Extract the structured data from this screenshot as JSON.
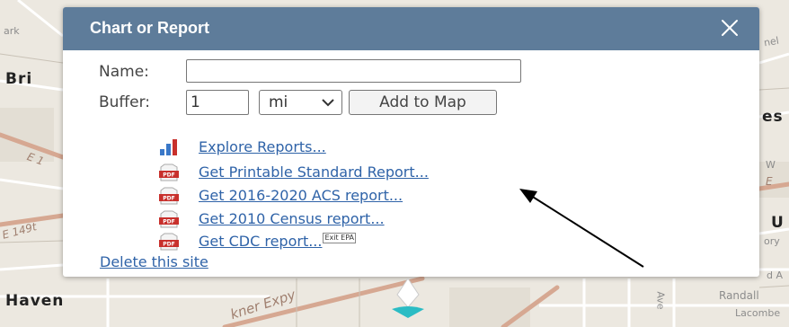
{
  "map": {
    "labels": {
      "park": "ark",
      "bri": "Bri",
      "nel": "nel",
      "es": "es",
      "e1a": "E 1",
      "w": "W",
      "e": "E",
      "e149": "E 149t",
      "u": "U",
      "ory": "ory",
      "da": "d A",
      "haven": "Haven",
      "expy": "kner Expy",
      "ave": "Ave",
      "randall": "Randall",
      "lacombe": "Lacombe"
    }
  },
  "popup": {
    "title": "Chart or Report",
    "close_icon": "close-icon",
    "form": {
      "name_label": "Name:",
      "name_value": "",
      "buffer_label": "Buffer:",
      "buffer_value": "1",
      "unit_selected": "mi",
      "add_button": "Add to Map"
    },
    "reports": [
      {
        "icon": "bar-chart-icon",
        "label": "Explore Reports..."
      },
      {
        "icon": "pdf-icon",
        "label": "Get Printable Standard Report..."
      },
      {
        "icon": "pdf-icon",
        "label": "Get 2016-2020 ACS report..."
      },
      {
        "icon": "pdf-icon",
        "label": "Get 2010 Census report..."
      },
      {
        "icon": "pdf-icon",
        "label": "Get CDC report..."
      }
    ],
    "exit_badge": "Exit EPA",
    "delete_link": "Delete this site",
    "pdf_icon_text": "PDF"
  },
  "colors": {
    "header": "#5e7c9a",
    "link": "#2f63a8",
    "pdf_red": "#c8302c",
    "marker": "#2bbcc4"
  }
}
